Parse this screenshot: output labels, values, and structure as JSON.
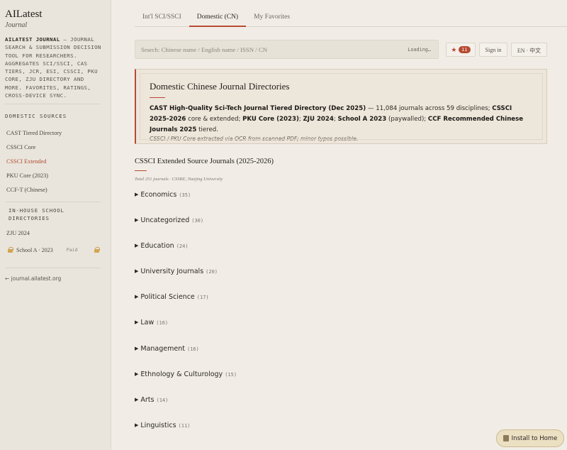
{
  "brand": {
    "title": "AILatest",
    "subtitle": "Journal",
    "desc_name": "AILATEST JOURNAL",
    "desc_text": " — JOURNAL SEARCH & SUBMISSION DECISION TOOL FOR RESEARCHERS. AGGREGATES SCI/SSCI, CAS TIERS, JCR, ESI, CSSCI, PKU CORE, ZJU DIRECTORY AND MORE. FAVORITES, RATINGS, CROSS-DEVICE SYNC."
  },
  "sidebar": {
    "domestic_heading": "DOMESTIC SOURCES",
    "items": [
      {
        "label": "CAST Tiered Directory",
        "active": false
      },
      {
        "label": "CSSCI Core",
        "active": false
      },
      {
        "label": "CSSCI Extended",
        "active": true
      },
      {
        "label": "PKU Core (2023)",
        "active": false
      },
      {
        "label": "CCF-T (Chinese)",
        "active": false
      }
    ],
    "school_heading": "IN-HOUSE SCHOOL DIRECTORIES",
    "zju_label": "ZJU 2024",
    "school_a_label": "School A · 2023",
    "school_a_badge": "Paid",
    "back_link": "← journal.ailatest.org"
  },
  "tabs": [
    {
      "label": "Int'l SCI/SSCI",
      "active": false
    },
    {
      "label": "Domestic (CN)",
      "active": true
    },
    {
      "label": "My Favorites",
      "active": false
    }
  ],
  "search": {
    "placeholder": "Search: Chinese name / English name / ISSN / CN",
    "status": "Loading…"
  },
  "header_buttons": {
    "favorites_count": "11",
    "signin_label": "Sign in",
    "lang_label": "EN · 中文"
  },
  "callout": {
    "title": "Domestic Chinese Journal Directories",
    "s1_bold": "CAST High-Quality Sci-Tech Journal Tiered Directory (Dec 2025)",
    "s1_text": " — 11,084 journals across 59 disciplines; ",
    "s2_bold": "CSSCI 2025-2026",
    "s2_text": " core & extended; ",
    "s3_bold": "PKU Core (2023)",
    "s3_text": "; ",
    "s4_bold": "ZJU 2024",
    "s4_text": "; ",
    "s5_bold": "School A 2023",
    "s5_text": " (paywalled); ",
    "s6_bold": "CCF Recommended Chinese Journals 2025",
    "s6_text": " tiered.",
    "note": "CSSCI / PKU Core extracted via OCR from scanned PDF; minor typos possible."
  },
  "section": {
    "title": "CSSCI Extended Source Journals (2025-2026)",
    "subtitle": "Total 251 journals · CSSRE, Nanjing University"
  },
  "categories": [
    {
      "name": "Economics",
      "count": "(35)"
    },
    {
      "name": "Uncategorized",
      "count": "(30)"
    },
    {
      "name": "Education",
      "count": "(24)"
    },
    {
      "name": "University Journals",
      "count": "(20)"
    },
    {
      "name": "Political Science",
      "count": "(17)"
    },
    {
      "name": "Law",
      "count": "(16)"
    },
    {
      "name": "Management",
      "count": "(16)"
    },
    {
      "name": "Ethnology & Culturology",
      "count": "(15)"
    },
    {
      "name": "Arts",
      "count": "(14)"
    },
    {
      "name": "Linguistics",
      "count": "(11)"
    }
  ],
  "install_label": "Install to Home",
  "colors": {
    "accent": "#b84b33",
    "background": "#f1ede6",
    "sidebar": "#e9e5dc"
  }
}
